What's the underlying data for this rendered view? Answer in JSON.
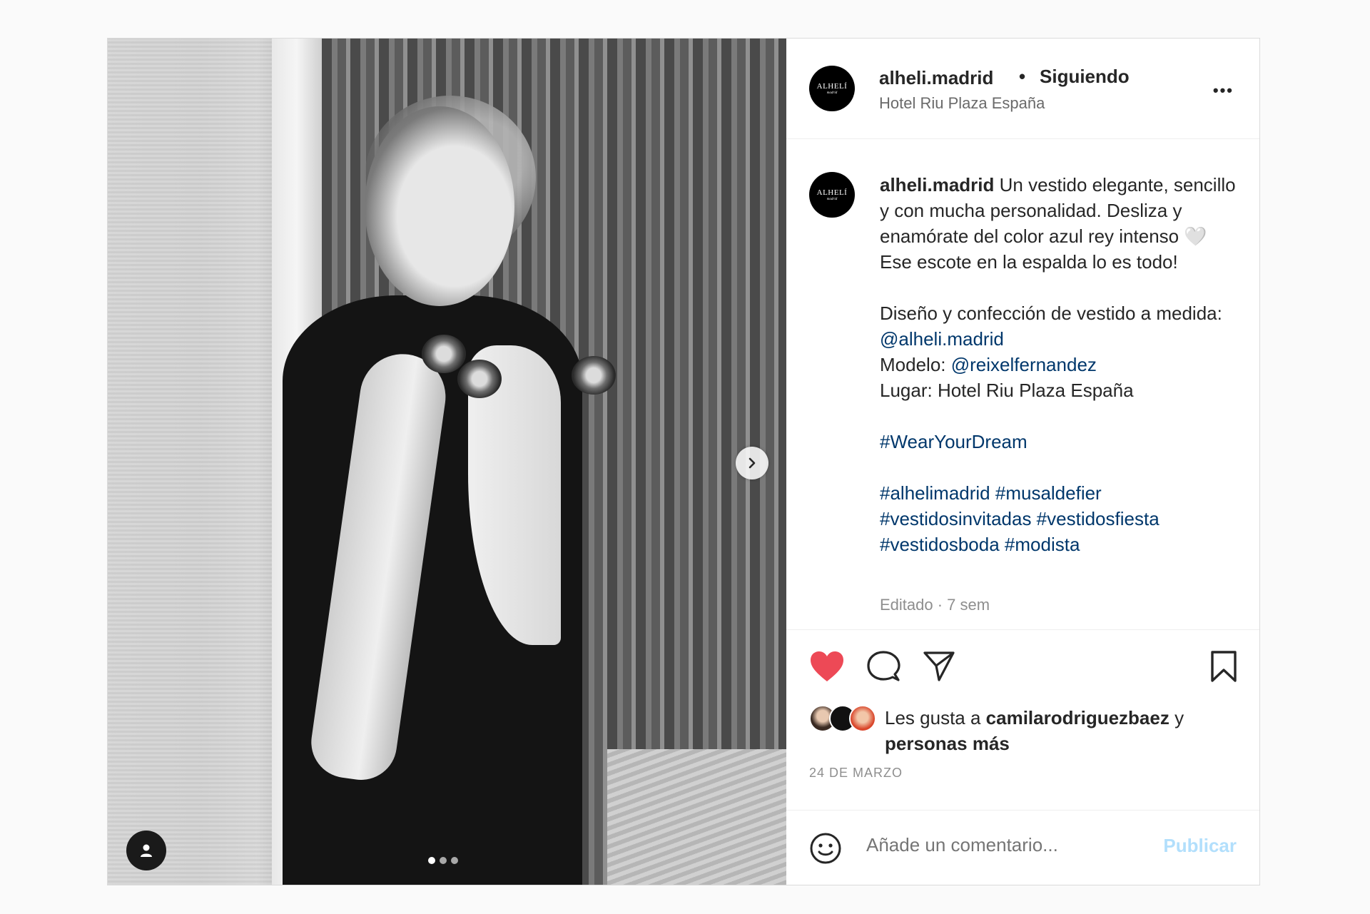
{
  "post": {
    "username": "alheli.madrid",
    "separator": "•",
    "following_label": "Siguiendo",
    "location": "Hotel Riu Plaza España",
    "more_label": "•••",
    "avatar": {
      "brand": "ALHELÍ",
      "sub": "madrid"
    },
    "caption": {
      "username": "alheli.madrid",
      "line1": " Un vestido elegante, sencillo y con mucha personalidad. Desliza y enamórate del color azul rey intenso 🤍 Ese escote en la espalda lo es todo!",
      "design_prefix": "Diseño y confección de vestido a medida: ",
      "design_mention": "@alheli.madrid",
      "model_prefix": "Modelo: ",
      "model_mention": "@reixelfernandez",
      "place": "Lugar: Hotel Riu Plaza España",
      "hashtag_main": "#WearYourDream",
      "hashtags": "#alhelimadrid #musaldefier #vestidosinvitadas #vestidosfiesta #vestidosboda #modista"
    },
    "edited": "Editado · 7 sem",
    "likes": {
      "prefix": "Les gusta a ",
      "user": "camilarodriguezbaez",
      "middle": " y ",
      "others": "personas más"
    },
    "date": "24 DE MARZO",
    "comment_placeholder": "Añade un comentario...",
    "publish_label": "Publicar",
    "carousel": {
      "total": 3,
      "active": 1
    }
  },
  "colors": {
    "like": "#ed4956",
    "link": "#00376b",
    "publish_disabled": "#b2dffc"
  }
}
